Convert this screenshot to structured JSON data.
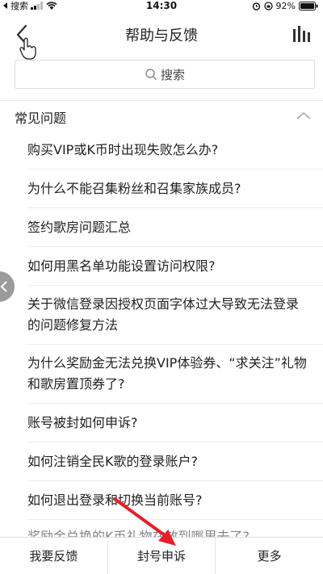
{
  "status": {
    "carrier": "搜索",
    "time": "14:30",
    "battery": "92%"
  },
  "nav": {
    "title": "帮助与反馈"
  },
  "search": {
    "label": "搜索"
  },
  "section": {
    "title": "常见问题"
  },
  "faq": [
    "购买VIP或K币时出现失败怎么办?",
    "为什么不能召集粉丝和召集家族成员?",
    "签约歌房问题汇总",
    "如何用黑名单功能设置访问权限?",
    "关于微信登录因授权页面字体过大导致无法登录的问题修复方法",
    "为什么奖励金无法兑换VIP体验券、“求关注”礼物和歌房置顶券了?",
    "账号被封如何申诉?",
    "如何注销全民K歌的登录账户?",
    "如何退出登录和切换当前账号?",
    "奖励金兑换的K币礼物在放到哪里去了?"
  ],
  "bottom": {
    "feedback": "我要反馈",
    "appeal": "封号申诉",
    "more": "更多"
  },
  "colors": {
    "arrow": "#e5202a"
  }
}
